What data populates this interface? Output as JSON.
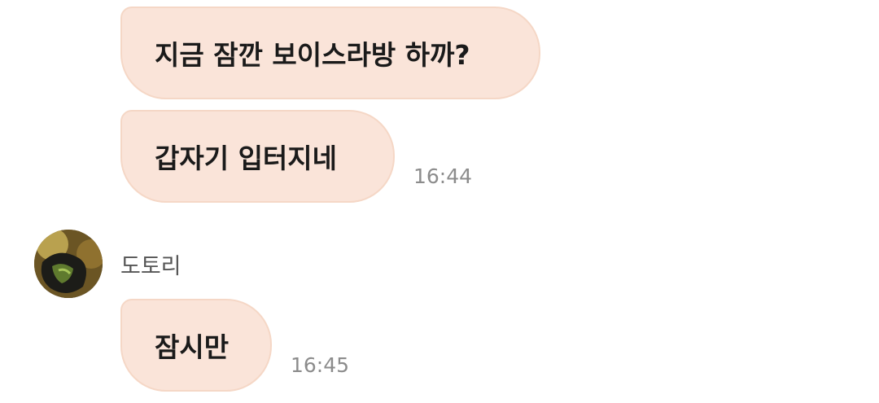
{
  "messages": [
    {
      "text": "지금 잠깐 보이스라방 하까?"
    },
    {
      "text": "갑자기 입터지네",
      "time": "16:44"
    },
    {
      "text": "잠시만",
      "time": "16:45"
    }
  ],
  "sender": {
    "name": "도토리",
    "avatar_icon": "profile-photo-avatar"
  },
  "colors": {
    "bubble_fill": "#fae4d9",
    "bubble_border": "#f5d7c6",
    "timestamp": "#8c8c8c"
  }
}
